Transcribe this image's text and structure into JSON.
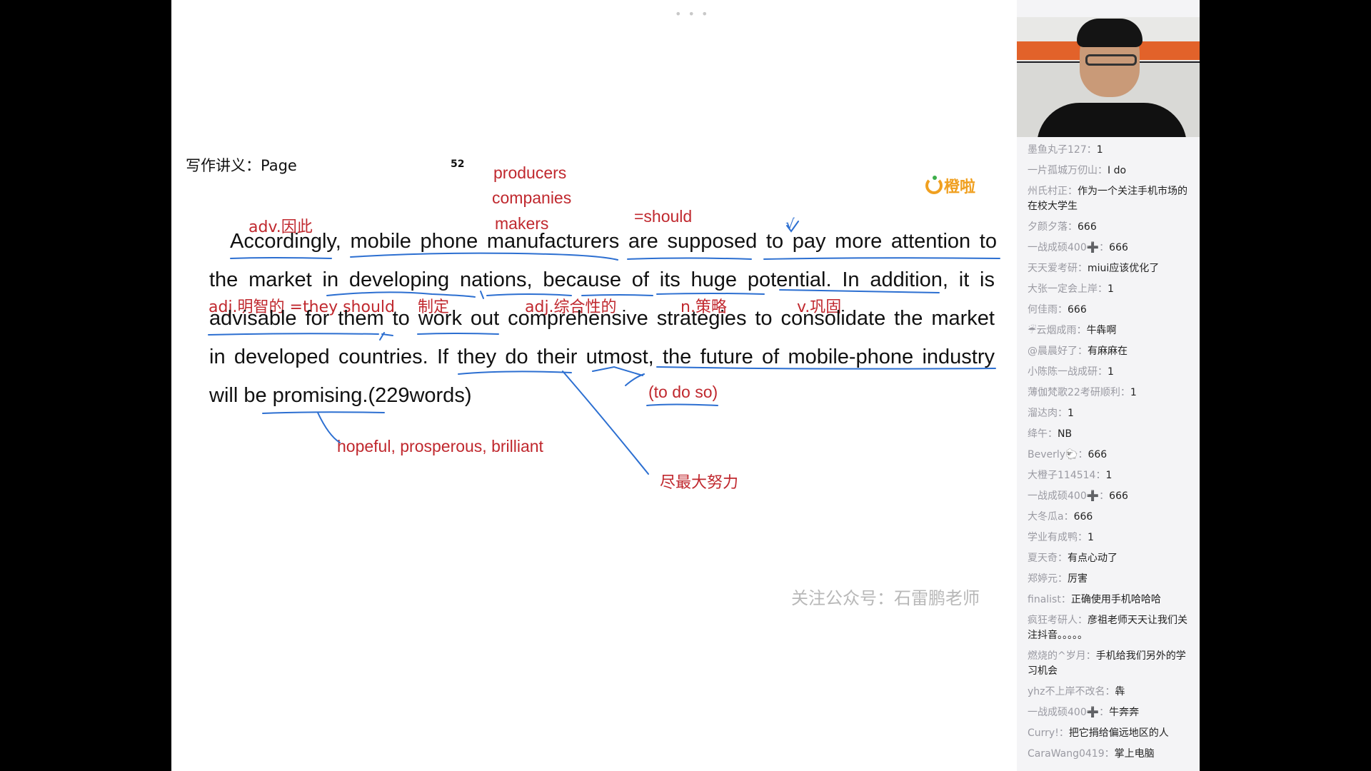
{
  "slide": {
    "dots": "• • •",
    "header_label": "写作讲义：Page",
    "page_number": "52",
    "logo_text": "橙啦",
    "lines": [
      "Accordingly, mobile phone manufacturers are supposed to  pay more attention to",
      "the market in developing nations, because of its huge potential. In addition, it is",
      "advisable for them to work out comprehensive strategies to consolidate the market",
      "in developed countries. If they do their utmost, the future of mobile-phone industry",
      "will be promising.(229words)"
    ],
    "annotations": {
      "producers": "producers",
      "companies": "companies",
      "makers": "makers",
      "adv": "adv.因此",
      "should": "=should",
      "tick": "√",
      "adj_mingzhi": "adj.明智的 =they should",
      "zhiding": "制定",
      "adj_zonghe": "adj.综合性的",
      "n_celue": "n.策略",
      "v_gonggu": "v.巩固",
      "to_do_so": "(to do so)",
      "synonyms": "hopeful, prosperous, brilliant",
      "jinzuida": "尽最大努力"
    },
    "watermark": "关注公众号：石雷鹏老师"
  },
  "sidebar": {
    "comments": [
      {
        "nick": "墨鱼丸子127",
        "text": "1"
      },
      {
        "nick": "一片孤城万仞山",
        "text": "I do"
      },
      {
        "nick": "州氏村正",
        "text": "作为一个关注手机市场的在校大学生"
      },
      {
        "nick": "夕颜夕落",
        "text": "666"
      },
      {
        "nick": "一战成硕400➕",
        "text": "666"
      },
      {
        "nick": "天天爱考研",
        "text": "miui应该优化了"
      },
      {
        "nick": "大张一定会上岸",
        "text": "1"
      },
      {
        "nick": "何佳雨",
        "text": "666"
      },
      {
        "nick": "☔云烟成雨",
        "text": "牛犇啊"
      },
      {
        "nick": "@晨晨好了",
        "text": "有麻麻在"
      },
      {
        "nick": "小陈陈一战成研",
        "text": "1"
      },
      {
        "nick": "薄伽梵歌22考研顺利",
        "text": "1"
      },
      {
        "nick": "溜达肉",
        "text": "1"
      },
      {
        "nick": "绛午",
        "text": "NB"
      },
      {
        "nick": "Beverly🐑",
        "text": "666"
      },
      {
        "nick": "大橙子114514",
        "text": "1"
      },
      {
        "nick": "一战成硕400➕",
        "text": "666"
      },
      {
        "nick": "大冬瓜a",
        "text": "666"
      },
      {
        "nick": "学业有成鸭",
        "text": "1"
      },
      {
        "nick": "夏天奇",
        "text": "有点心动了"
      },
      {
        "nick": "郑婷元",
        "text": "厉害"
      },
      {
        "nick": "finalist",
        "text": "正确使用手机哈哈哈"
      },
      {
        "nick": "疯狂考研人",
        "text": "彦祖老师天天让我们关注抖音。。。。。"
      },
      {
        "nick": "燃烧的^岁月",
        "text": "手机给我们另外的学习机会"
      },
      {
        "nick": "yhz不上岸不改名",
        "text": "犇"
      },
      {
        "nick": "一战成硕400➕",
        "text": "牛奔奔"
      },
      {
        "nick": "Curry!",
        "text": "把它捐给偏远地区的人"
      },
      {
        "nick": "CaraWang0419",
        "text": "掌上电脑"
      }
    ]
  }
}
